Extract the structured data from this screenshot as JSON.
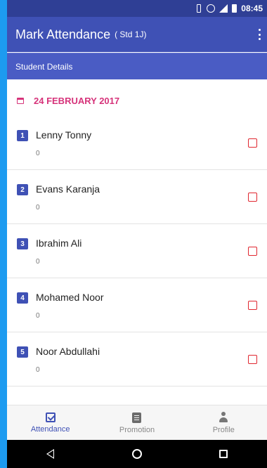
{
  "status_bar": {
    "time": "08:45"
  },
  "app_bar": {
    "title": "Mark Attendance",
    "subtitle": "( Std 1J)"
  },
  "sub_header": {
    "label": "Student Details"
  },
  "date": {
    "text": "24 FEBRUARY 2017"
  },
  "students": [
    {
      "number": "1",
      "name": "Lenny Tonny",
      "count": "0"
    },
    {
      "number": "2",
      "name": "Evans Karanja",
      "count": "0"
    },
    {
      "number": "3",
      "name": "Ibrahim Ali",
      "count": "0"
    },
    {
      "number": "4",
      "name": "Mohamed Noor",
      "count": "0"
    },
    {
      "number": "5",
      "name": "Noor Abdullahi",
      "count": "0"
    }
  ],
  "bottom_nav": {
    "items": [
      {
        "label": "Attendance",
        "icon": "checkbox-icon",
        "active": true
      },
      {
        "label": "Promotion",
        "icon": "document-icon",
        "active": false
      },
      {
        "label": "Profile",
        "icon": "person-icon",
        "active": false
      }
    ]
  },
  "colors": {
    "primary": "#3f51b5",
    "accent": "#d6337a",
    "checkbox": "#e0262f"
  }
}
